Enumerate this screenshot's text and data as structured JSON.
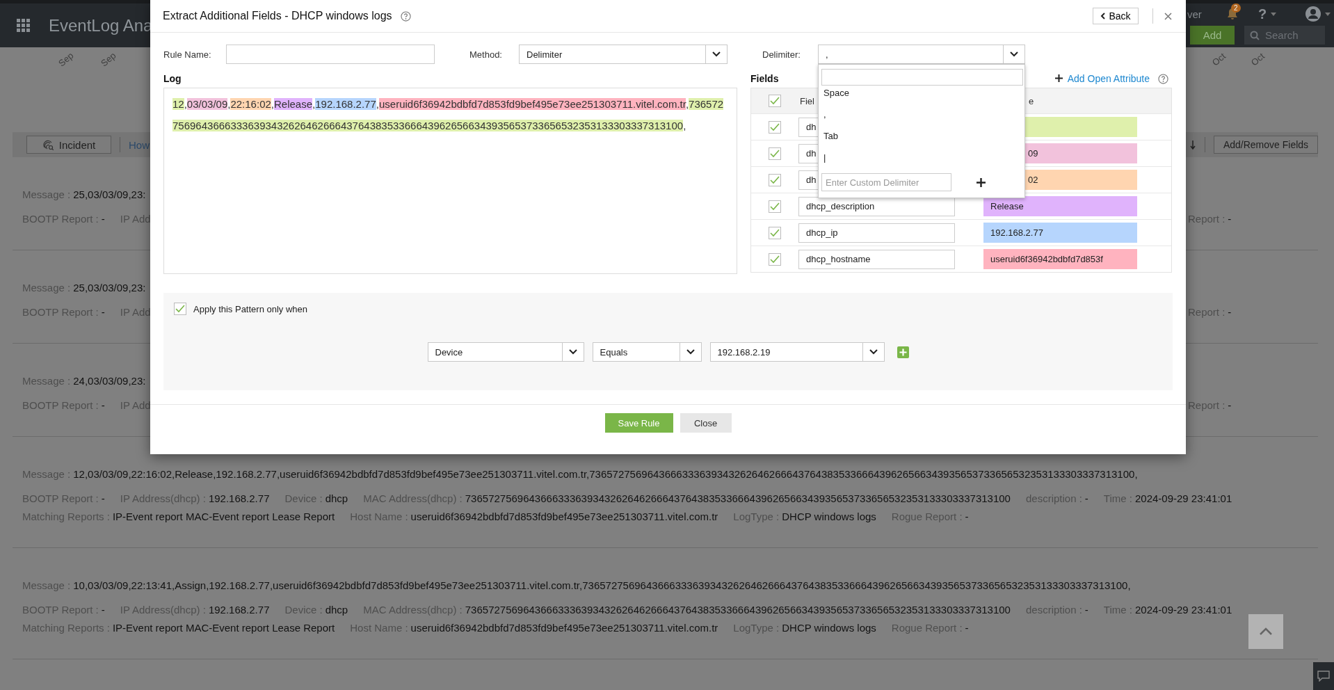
{
  "header": {
    "app_title": "EventLog Ana",
    "user_fragment": "ver",
    "notification_count": "2",
    "help": "?",
    "add_button": "Add",
    "search_placeholder": "Search"
  },
  "timeline_left": [
    "Sep",
    "Sep"
  ],
  "timeline_right": [
    "Oct",
    "Oct"
  ],
  "toolbar": {
    "incident_button": "Incident",
    "link": "How",
    "add_remove_button": "Add/Remove Fields"
  },
  "records": [
    {
      "lines": [
        [
          {
            "label": "Message :",
            "value": "25,03/03/09,23:"
          }
        ],
        [
          {
            "label": "BOOTP Report :",
            "value": "-"
          },
          {
            "label": "IP Add"
          }
        ]
      ],
      "right": {
        "label": "Report :",
        "value": "-"
      }
    },
    {
      "lines": [
        [
          {
            "label": "Message :",
            "value": "25,03/03/09,23:"
          }
        ],
        [
          {
            "label": "BOOTP Report :",
            "value": "-"
          },
          {
            "label": "IP Add"
          }
        ]
      ],
      "right": {
        "label": "Report :",
        "value": "-"
      }
    },
    {
      "lines": [
        [
          {
            "label": "Message :",
            "value": "24,03/03/09,23:"
          }
        ],
        [
          {
            "label": "BOOTP Report :",
            "value": "-"
          },
          {
            "label": "IP Add"
          }
        ]
      ],
      "right": {
        "label": "Report :",
        "value": "-"
      }
    },
    {
      "lines": [
        [
          {
            "label": "Message :",
            "value": "12,03/03/09,22:16:02,Release,192.168.2.77,useruid6f36942bdbfd7d853fd9bef495e73ee251303711.vitel.com.tr,7365727569643666333639343262646266643764383533666439626566343935653733656532353133303337313100,"
          }
        ],
        [
          {
            "label": "BOOTP Report :",
            "value": "-"
          },
          {
            "label": "IP Address(dhcp) :",
            "value": "192.168.2.77"
          },
          {
            "label": "Device :",
            "value": "dhcp"
          },
          {
            "label": "MAC Address(dhcp) :",
            "value": "7365727569643666333639343262646266643764383533666439626566343935653733656532353133303337313100"
          },
          {
            "label": "description :",
            "value": "-"
          },
          {
            "label": "Time :",
            "value": "2024-09-29 23:41:01"
          }
        ],
        [
          {
            "label": "Matching Reports :",
            "value": "IP-Event report MAC-Event report Lease Report"
          },
          {
            "label": "Host Name :",
            "value": "useruid6f36942bdbfd7d853fd9bef495e73ee251303711.vitel.com.tr"
          },
          {
            "label": "LogType :",
            "value": "DHCP windows logs"
          },
          {
            "label": "Rogue Report :",
            "value": "-"
          }
        ]
      ]
    },
    {
      "lines": [
        [
          {
            "label": "Message :",
            "value": "10,03/03/09,22:13:41,Assign,192.168.2.77,useruid6f36942bdbfd7d853fd9bef495e73ee251303711.vitel.com.tr,7365727569643666333639343262646266643764383533666439626566343935653733656532353133303337313100,"
          }
        ],
        [
          {
            "label": "BOOTP Report :",
            "value": "-"
          },
          {
            "label": "IP Address(dhcp) :",
            "value": "192.168.2.77"
          },
          {
            "label": "Device :",
            "value": "dhcp"
          },
          {
            "label": "MAC Address(dhcp) :",
            "value": "7365727569643666333639343262646266643764383533666439626566343935653733656532353133303337313100"
          },
          {
            "label": "description :",
            "value": "-"
          },
          {
            "label": "Time :",
            "value": "2024-09-29 23:41:01"
          }
        ],
        [
          {
            "label": "Matching Reports :",
            "value": "IP-Event report MAC-Event report Lease Report"
          },
          {
            "label": "Host Name :",
            "value": "useruid6f36942bdbfd7d853fd9bef495e73ee251303711.vitel.com.tr"
          },
          {
            "label": "LogType :",
            "value": "DHCP windows logs"
          },
          {
            "label": "Rogue Report :",
            "value": "-"
          }
        ]
      ]
    }
  ],
  "modal": {
    "title": "Extract Additional Fields - DHCP windows logs",
    "back_button": "Back",
    "rule_name": {
      "label": "Rule Name:"
    },
    "method": {
      "label": "Method:",
      "value": "Delimiter"
    },
    "delimiter": {
      "label": "Delimiter:",
      "value": ",",
      "expanded": true,
      "options": [
        "Space",
        ",",
        "Tab",
        "|"
      ],
      "custom_placeholder": "Enter Custom Delimiter"
    },
    "log": {
      "heading": "Log",
      "tokens": [
        {
          "text": "12",
          "color": "#dff0ac"
        },
        {
          "text": ","
        },
        {
          "text": "03/03/09",
          "color": "#f2c2dc"
        },
        {
          "text": ","
        },
        {
          "text": "22:16:02",
          "color": "#ffd5b0"
        },
        {
          "text": ","
        },
        {
          "text": "Release",
          "color": "#e0b3fc"
        },
        {
          "text": ","
        },
        {
          "text": "192.168.2.77",
          "color": "#b6d5fd"
        },
        {
          "text": ","
        },
        {
          "text": "useruid6f36942bdbfd7d853fd9bef495e73ee251303711.vitel.com.tr",
          "color": "#ffb3bf"
        },
        {
          "text": ","
        },
        {
          "text": "7365727569643666333639343262646266643764383533666439626566343935653733656532353133303337313100",
          "color": "#dff0ac"
        },
        {
          "text": ","
        }
      ]
    },
    "fields": {
      "heading": "Fields",
      "add_link": "Add Open Attribute",
      "all_checked": true,
      "columns": [
        "Fiel",
        "e"
      ],
      "rows": [
        {
          "checked": true,
          "name": "dh",
          "color": "#dff0ac"
        },
        {
          "checked": true,
          "name": "dh",
          "value": "09",
          "color": "#f2c2dc"
        },
        {
          "checked": true,
          "name": "dh",
          "value": "02",
          "color": "#ffd5b0"
        },
        {
          "checked": true,
          "name": "dhcp_description",
          "value": "Release",
          "color": "#e0b3fc"
        },
        {
          "checked": true,
          "name": "dhcp_ip",
          "value": "192.168.2.77",
          "color": "#b6d5fd"
        },
        {
          "checked": true,
          "name": "dhcp_hostname",
          "value": "useruid6f36942bdbfd7d853f",
          "color": "#ffb3bf"
        }
      ]
    },
    "conditions": {
      "enabled": true,
      "label": "Apply this Pattern only when",
      "field": "Device",
      "operator": "Equals",
      "value": "192.168.2.19"
    },
    "save_button": "Save Rule",
    "close_button": "Close"
  }
}
